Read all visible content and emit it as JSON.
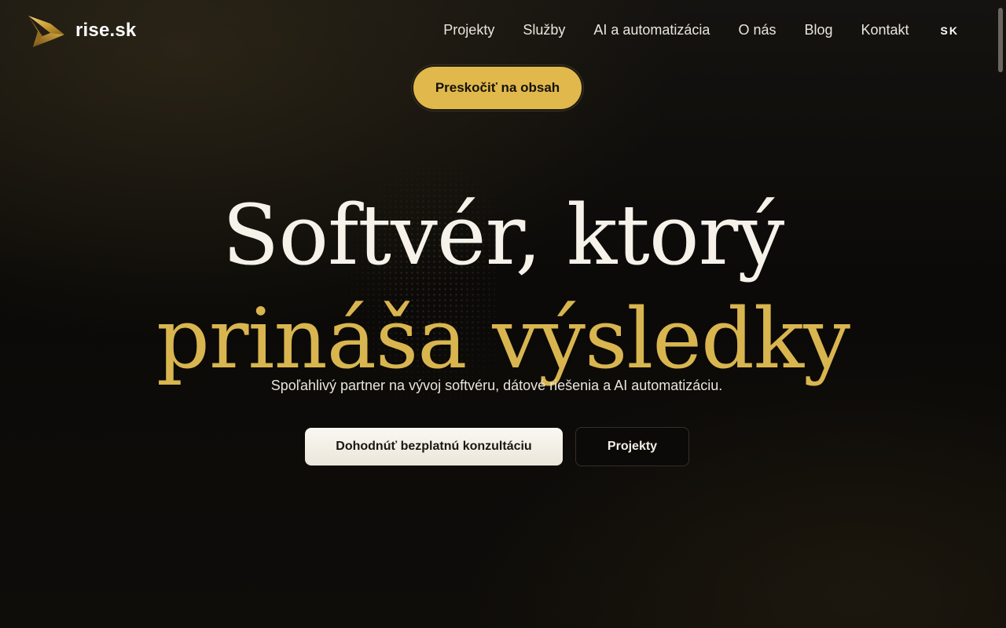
{
  "header": {
    "logo_text": "rise.sk",
    "nav": [
      {
        "label": "Projekty"
      },
      {
        "label": "Služby"
      },
      {
        "label": "AI a automatizácia"
      },
      {
        "label": "O nás"
      },
      {
        "label": "Blog"
      },
      {
        "label": "Kontakt"
      }
    ],
    "language": "SK"
  },
  "skip_link": {
    "label": "Preskočiť na obsah"
  },
  "hero": {
    "title_line1": "Softvér, ktorý",
    "title_line2": "prináša výsledky",
    "subtitle": "Spoľahlivý partner na vývoj softvéru, dátové riešenia a AI automatizáciu.",
    "primary_button": "Dohodnúť bezplatnú konzultáciu",
    "secondary_button": "Projekty"
  },
  "colors": {
    "accent_gold": "#d9b54f",
    "skip_button_bg": "#e0b84c",
    "background": "#0b0a08",
    "text_light": "#f6f2ea"
  },
  "icons": {
    "logo": "gold-arrow-logo-icon"
  }
}
